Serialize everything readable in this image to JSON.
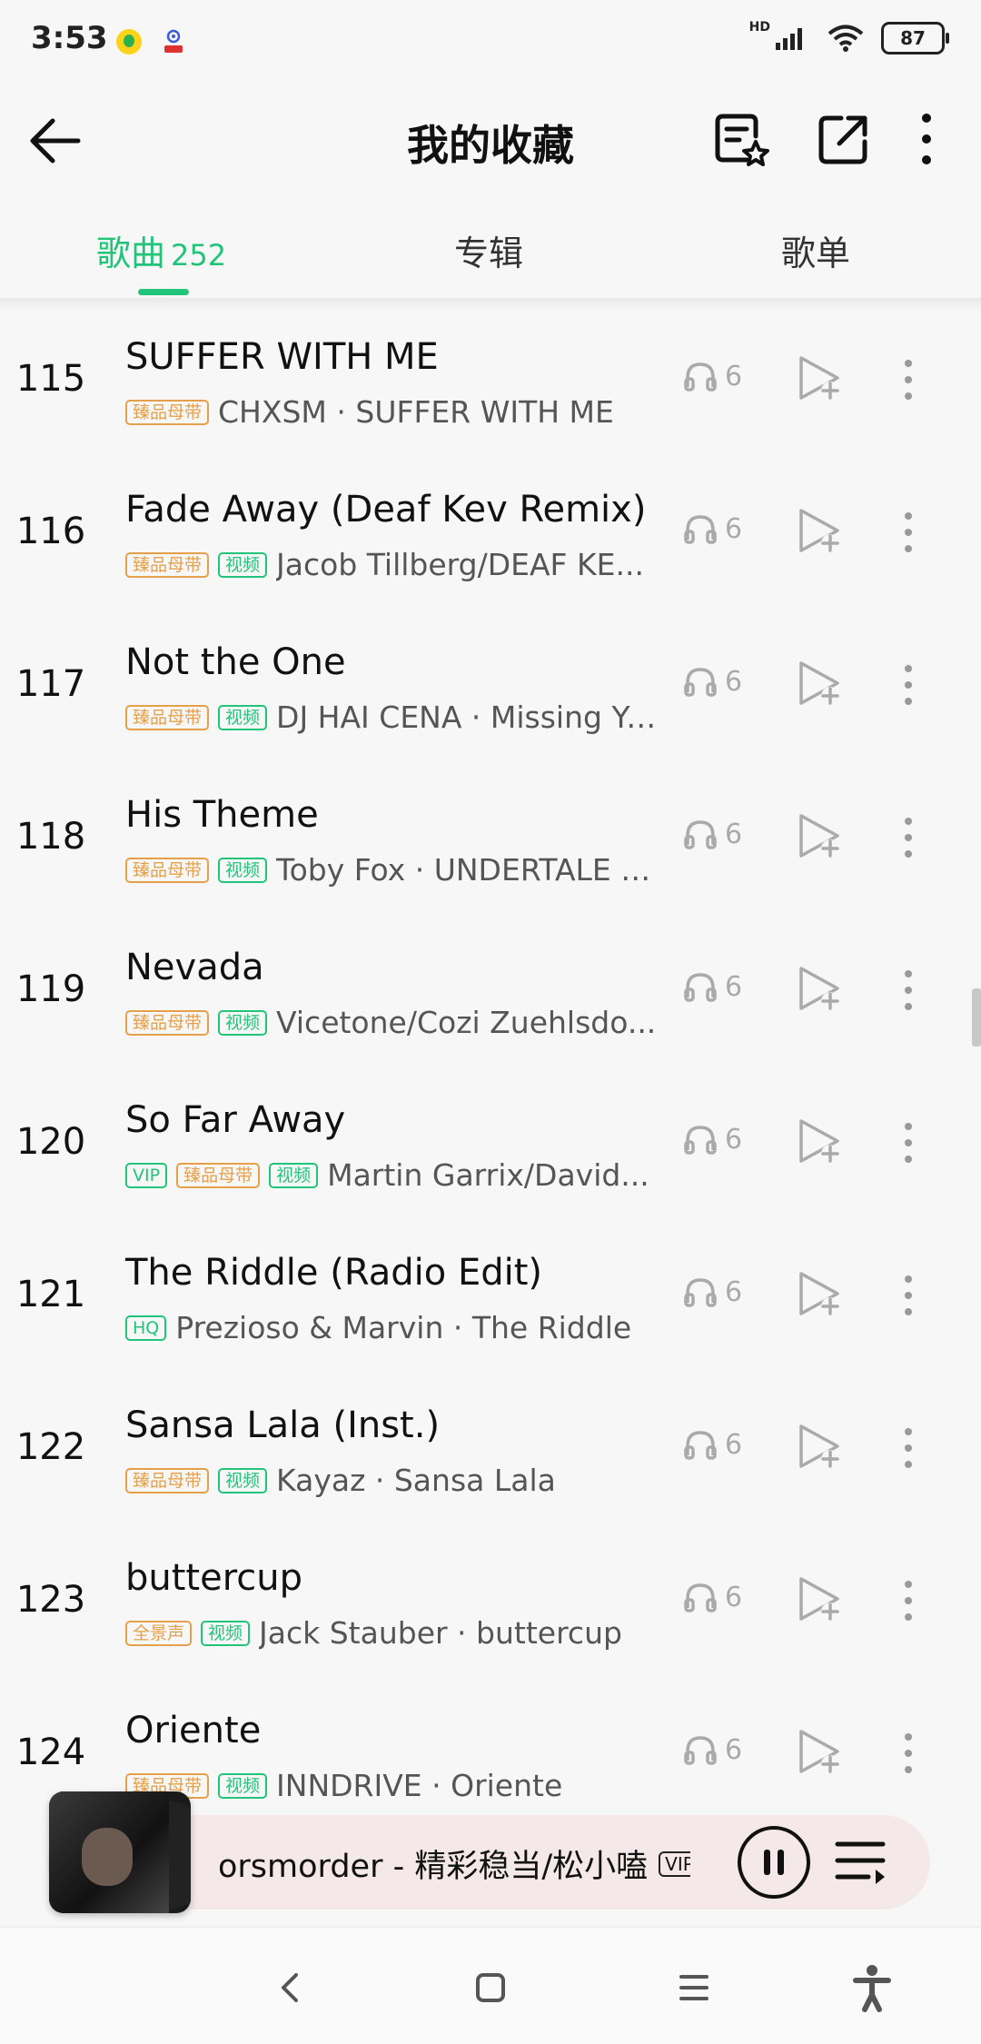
{
  "status_bar": {
    "time": "3:53",
    "signal_label": "HD",
    "battery": "87"
  },
  "header": {
    "title": "我的收藏",
    "icons": [
      "back-arrow-icon",
      "favorite-list-icon",
      "share-icon",
      "more-vertical-icon"
    ]
  },
  "tabs": [
    {
      "label": "歌曲",
      "count": "252",
      "active": true
    },
    {
      "label": "专辑",
      "count": "",
      "active": false
    },
    {
      "label": "歌单",
      "count": "",
      "active": false
    }
  ],
  "songs": [
    {
      "index": "115",
      "title": "SUFFER WITH ME",
      "tags": [
        "臻品母带"
      ],
      "subtitle": "CHXSM · SUFFER WITH ME",
      "plays": "6"
    },
    {
      "index": "116",
      "title": "Fade Away (Deaf Kev Remix)",
      "tags": [
        "臻品母带",
        "视频"
      ],
      "subtitle": "Jacob Tillberg/DEAF KE...",
      "plays": "6"
    },
    {
      "index": "117",
      "title": "Not the One",
      "tags": [
        "臻品母带",
        "视频"
      ],
      "subtitle": "DJ HAI CENA · Missing You",
      "plays": "6"
    },
    {
      "index": "118",
      "title": "His Theme",
      "tags": [
        "臻品母带",
        "视频"
      ],
      "subtitle": "Toby Fox · UNDERTALE S...",
      "plays": "6"
    },
    {
      "index": "119",
      "title": "Nevada",
      "tags": [
        "臻品母带",
        "视频"
      ],
      "subtitle": "Vicetone/Cozi Zuehlsdo...",
      "plays": "6"
    },
    {
      "index": "120",
      "title": "So Far Away",
      "tags": [
        "VIP",
        "臻品母带",
        "视频"
      ],
      "subtitle": "Martin Garrix/David...",
      "plays": "6"
    },
    {
      "index": "121",
      "title": "The Riddle (Radio Edit)",
      "tags": [
        "HQ"
      ],
      "subtitle": "Prezioso & Marvin · The Riddle",
      "plays": "6"
    },
    {
      "index": "122",
      "title": "Sansa Lala (Inst.)",
      "tags": [
        "臻品母带",
        "视频"
      ],
      "subtitle": "Kayaz · Sansa Lala",
      "plays": "6"
    },
    {
      "index": "123",
      "title": "buttercup",
      "tags": [
        "全景声",
        "视频"
      ],
      "subtitle": "Jack Stauber · buttercup",
      "plays": "6"
    },
    {
      "index": "124",
      "title": "Oriente",
      "tags": [
        "臻品母带",
        "视频"
      ],
      "subtitle": "INNDRIVE · Oriente",
      "plays": "6"
    }
  ],
  "player": {
    "now_playing": "orsmorder - 精彩稳当/松小嗑",
    "vip_label": "VIP",
    "state": "playing"
  },
  "colors": {
    "accent": "#22c47a",
    "tag_orange": "#e6a04a",
    "background": "#f7f7f7",
    "player_bg": "#f4e8e8"
  }
}
